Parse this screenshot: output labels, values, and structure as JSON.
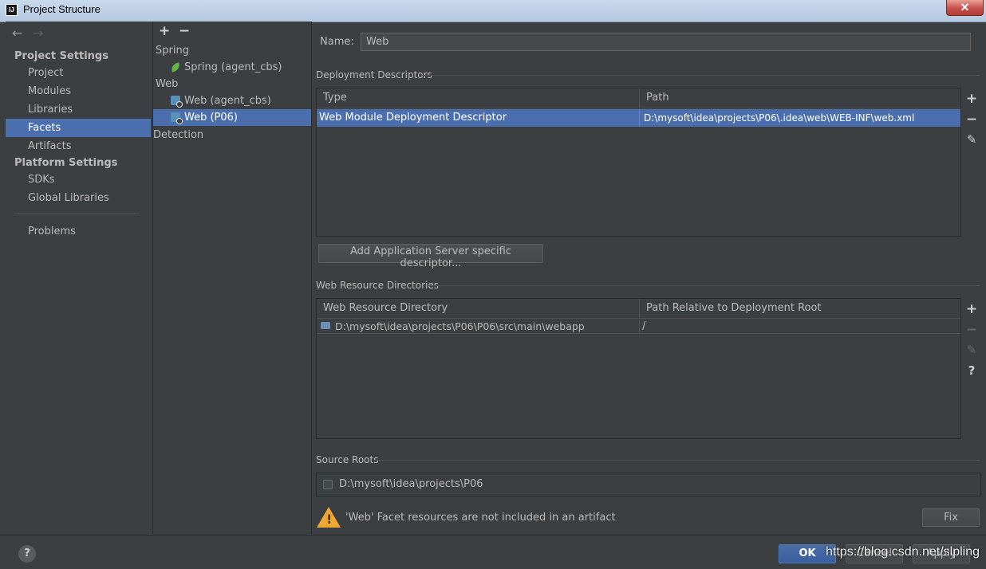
{
  "window": {
    "title": "Project Structure",
    "close_glyph": "✕"
  },
  "nav": {
    "back_glyph": "←",
    "forward_glyph": "→",
    "project_settings_heading": "Project Settings",
    "project_items": [
      "Project",
      "Modules",
      "Libraries",
      "Facets",
      "Artifacts"
    ],
    "platform_settings_heading": "Platform Settings",
    "platform_items": [
      "SDKs",
      "Global Libraries"
    ],
    "problems_label": "Problems",
    "selected": "Facets"
  },
  "tree": {
    "add_glyph": "+",
    "remove_glyph": "−",
    "spring_group": "Spring",
    "spring_item": "Spring (agent_cbs)",
    "web_group": "Web",
    "web_item_1": "Web (agent_cbs)",
    "web_item_2": "Web (P06)",
    "detection": "Detection",
    "selected": "Web (P06)"
  },
  "facet": {
    "name_label": "Name:",
    "name_value": "Web",
    "deployment_descriptors": {
      "title": "Deployment Descriptors",
      "columns": [
        "Type",
        "Path"
      ],
      "rows": [
        {
          "type": "Web Module Deployment Descriptor",
          "path": "D:\\mysoft\\idea\\projects\\P06\\.idea\\web\\WEB-INF\\web.xml"
        }
      ],
      "add_server_descriptor_button": "Add Application Server specific descriptor..."
    },
    "web_resource_directories": {
      "title": "Web Resource Directories",
      "columns": [
        "Web Resource Directory",
        "Path Relative to Deployment Root"
      ],
      "rows": [
        {
          "directory": "D:\\mysoft\\idea\\projects\\P06\\P06\\src\\main\\webapp",
          "relative_path": "/"
        }
      ]
    },
    "source_roots": {
      "title": "Source Roots",
      "items": [
        {
          "path": "D:\\mysoft\\idea\\projects\\P06",
          "checked": false
        }
      ]
    },
    "warning": {
      "text": "'Web' Facet resources are not included in an artifact",
      "fix_button": "Fix"
    }
  },
  "tools": {
    "add": "+",
    "remove": "−",
    "edit": "✎",
    "help": "?"
  },
  "bottom": {
    "help": "?",
    "ok": "OK",
    "cancel": "Cancel",
    "apply": "Apply"
  },
  "watermark": "https://blog.csdn.net/slpling",
  "colors": {
    "background": "#3c3f41",
    "selection": "#4b6eaf",
    "warning": "#f0a732",
    "spring_green": "#62b543"
  }
}
